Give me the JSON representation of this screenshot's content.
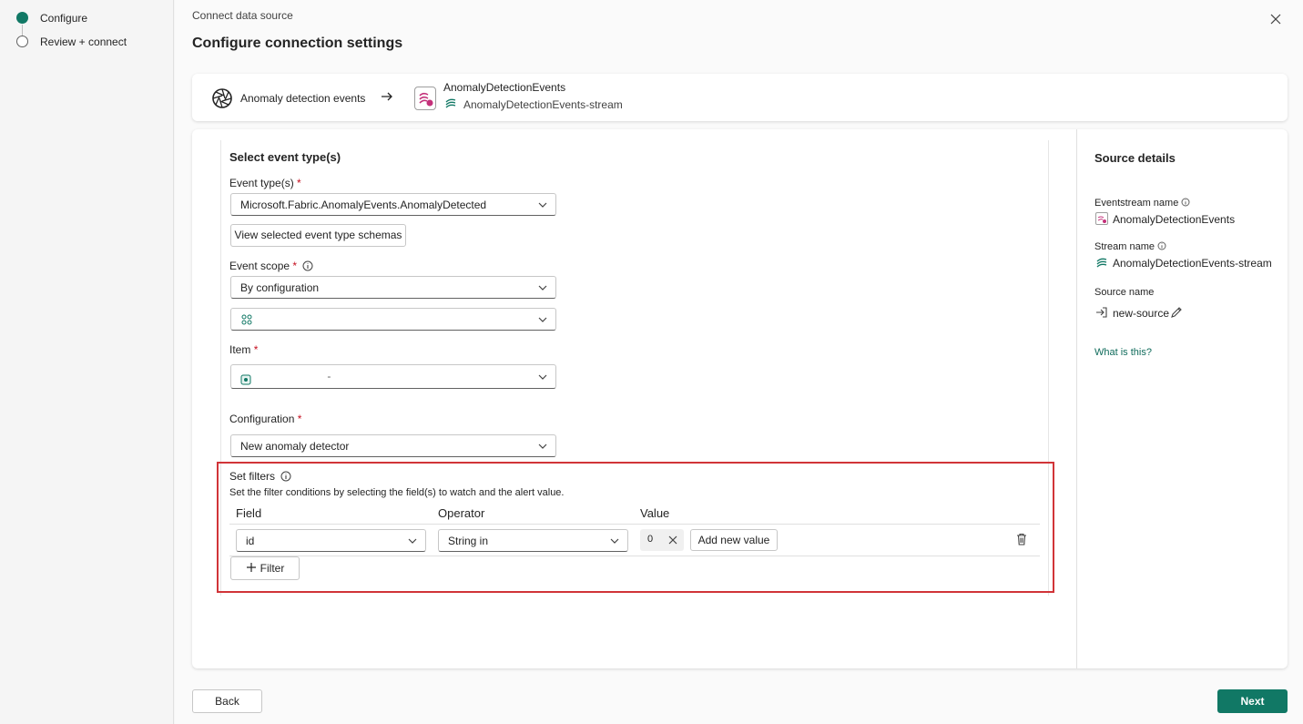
{
  "stepper": {
    "steps": [
      {
        "label": "Configure",
        "state": "active"
      },
      {
        "label": "Review + connect",
        "state": "pending"
      }
    ]
  },
  "header": {
    "breadcrumb": "Connect data source",
    "title": "Configure connection settings"
  },
  "flow": {
    "source_name": "Anomaly detection events",
    "dest_title": "AnomalyDetectionEvents",
    "dest_stream": "AnomalyDetectionEvents-stream"
  },
  "form": {
    "section_title": "Select event type(s)",
    "event_types_label": "Event type(s)",
    "event_types_value": "Microsoft.Fabric.AnomalyEvents.AnomalyDetected",
    "view_schemas_button": "View selected event type schemas",
    "event_scope_label": "Event scope",
    "event_scope_value": "By configuration",
    "workspace_value": "",
    "item_label": "Item",
    "item_value": "-",
    "configuration_label": "Configuration",
    "configuration_value": "New anomaly detector",
    "required_mark": "*"
  },
  "filters": {
    "title": "Set filters",
    "description": "Set the filter conditions by selecting the field(s) to watch and the alert value.",
    "columns": {
      "field": "Field",
      "operator": "Operator",
      "value": "Value"
    },
    "rows": [
      {
        "field": "id",
        "operator": "String in",
        "value_chip": "0",
        "add_value_button": "Add new value"
      }
    ],
    "add_filter_button": "Filter"
  },
  "source_details": {
    "title": "Source details",
    "eventstream_name_label": "Eventstream name",
    "eventstream_name_value": "AnomalyDetectionEvents",
    "stream_name_label": "Stream name",
    "stream_name_value": "AnomalyDetectionEvents-stream",
    "source_name_label": "Source name",
    "source_name_value": "new-source",
    "what_is_this_link": "What is this?"
  },
  "footer": {
    "back_button": "Back",
    "next_button": "Next"
  },
  "colors": {
    "accent": "#117865",
    "highlight_border": "#d13438",
    "link": "#0f6b5b"
  }
}
